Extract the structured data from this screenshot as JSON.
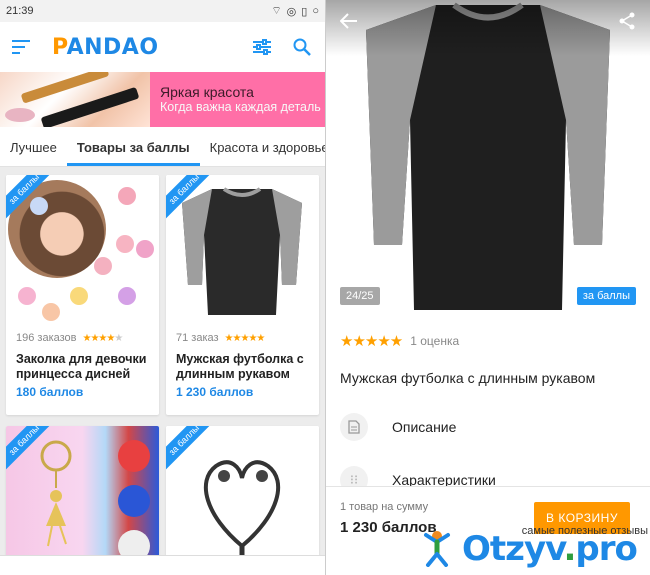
{
  "left_screen": {
    "status": {
      "time": "21:39"
    },
    "app": {
      "logo": "PANDAO"
    },
    "banner": {
      "title": "Яркая красота",
      "subtitle": "Когда важна каждая деталь"
    },
    "tabs": [
      {
        "label": "Лучшее"
      },
      {
        "label": "Товары за баллы"
      },
      {
        "label": "Красота и здоровье"
      }
    ],
    "active_tab": "Товары за баллы",
    "ribbon_label": "за баллы",
    "products": [
      {
        "orders": "196 заказов",
        "rating": 4,
        "title": "Заколка для девочки принцесса дисней",
        "price": "180 баллов"
      },
      {
        "orders": "71 заказ",
        "rating": 5,
        "title": "Мужская футболка с длинным рукавом",
        "price": "1 230 баллов"
      },
      {
        "orders": "",
        "rating": 0,
        "title": "",
        "price": ""
      },
      {
        "orders": "",
        "rating": 0,
        "title": "",
        "price": ""
      }
    ]
  },
  "right_screen": {
    "counter": "24/25",
    "badge": "за баллы",
    "rating": 5,
    "rating_text": "1 оценка",
    "title": "Мужская футболка с длинным рукавом",
    "rows": [
      {
        "label": "Описание",
        "icon": "document-icon"
      },
      {
        "label": "Характеристики",
        "icon": "sliders-icon"
      }
    ],
    "footer": {
      "sum_label": "1 товар на сумму",
      "price": "1 230 баллов",
      "cart_button": "В КОРЗИНУ"
    }
  },
  "watermark": {
    "tagline": "самые полезные отзывы",
    "logo_main": "Otzyv",
    "logo_dot": ".",
    "logo_tld": "pro"
  },
  "colors": {
    "accent": "#2196f3",
    "orange": "#ff9800",
    "star": "#ffa000"
  }
}
